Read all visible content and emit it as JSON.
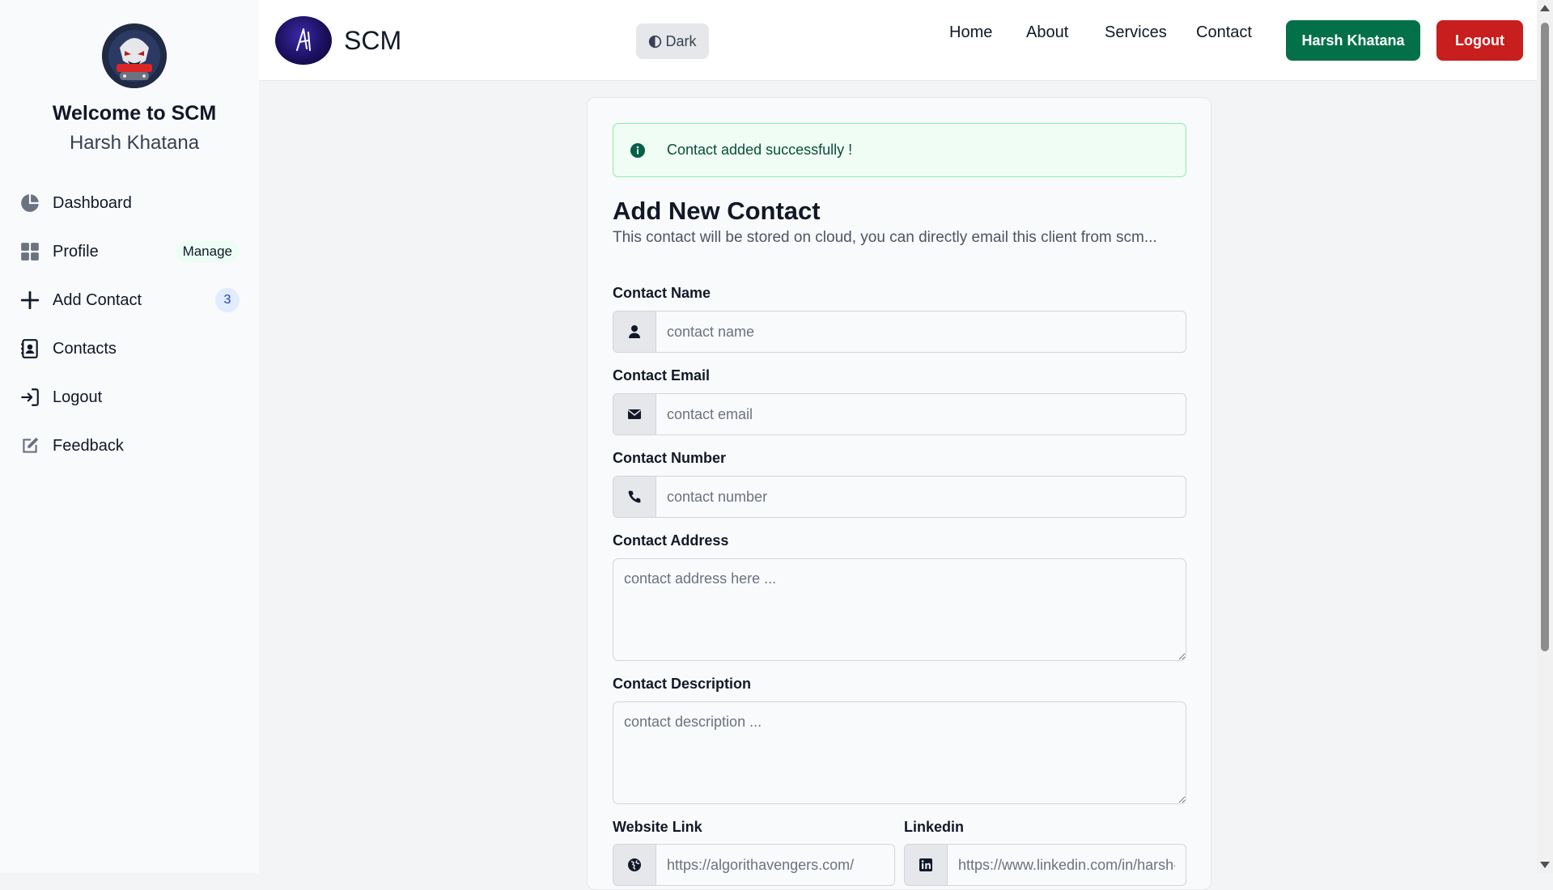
{
  "sidebar": {
    "welcome": "Welcome to SCM",
    "username": "Harsh Khatana",
    "items": [
      {
        "label": "Dashboard",
        "icon": "pie-chart-icon"
      },
      {
        "label": "Profile",
        "icon": "grid-icon",
        "badge": "Manage"
      },
      {
        "label": "Add Contact",
        "icon": "plus-icon",
        "badge": "3"
      },
      {
        "label": "Contacts",
        "icon": "address-book-icon"
      },
      {
        "label": "Logout",
        "icon": "sign-in-icon"
      },
      {
        "label": "Feedback",
        "icon": "edit-icon"
      }
    ]
  },
  "header": {
    "brand": "SCM",
    "theme_label": "Dark",
    "links": [
      "Home",
      "About",
      "Services",
      "Contact"
    ],
    "user_button": "Harsh Khatana",
    "logout_button": "Logout"
  },
  "alert": {
    "text": "Contact added successfully !"
  },
  "form": {
    "title": "Add New Contact",
    "subtitle": "This contact will be stored on cloud, you can directly email this client from scm...",
    "name": {
      "label": "Contact Name",
      "placeholder": "contact name",
      "value": ""
    },
    "email": {
      "label": "Contact Email",
      "placeholder": "contact email",
      "value": ""
    },
    "number": {
      "label": "Contact Number",
      "placeholder": "contact number",
      "value": ""
    },
    "address": {
      "label": "Contact Address",
      "placeholder": "contact address here ...",
      "value": ""
    },
    "description": {
      "label": "Contact Description",
      "placeholder": "contact description ...",
      "value": ""
    },
    "website": {
      "label": "Website Link",
      "placeholder": "https://algorithavengers.com/",
      "value": ""
    },
    "linkedin": {
      "label": "Linkedin",
      "placeholder": "https://www.linkedin.com/in/harsh-",
      "value": ""
    }
  },
  "colors": {
    "primary": "#04704a",
    "danger": "#c81e1e",
    "alert_bg": "#f0fdf4",
    "alert_border": "#86efac"
  }
}
